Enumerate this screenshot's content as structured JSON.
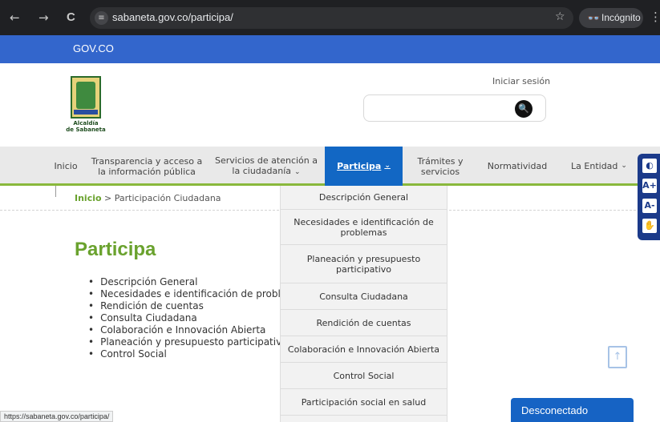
{
  "browser": {
    "url": "sabaneta.gov.co/participa/",
    "back_icon": "←",
    "forward_icon": "→",
    "reload_icon": "C",
    "site_info_icon": "≡",
    "star_icon": "☆",
    "incognito_label": "Incógnito",
    "incognito_icon": "👓",
    "menu_icon": "⋮",
    "status_url": "https://sabaneta.gov.co/participa/"
  },
  "govbar": {
    "label": "GOV.CO",
    "color": "#3366cc"
  },
  "header": {
    "logo_text_line1": "Alcaldía",
    "logo_text_line2": "de Sabaneta",
    "login": "Iniciar sesión",
    "search_placeholder": "",
    "search_icon": "🔍"
  },
  "menu": {
    "items": [
      {
        "label": "Inicio"
      },
      {
        "label": "Transparencia y acceso a la información pública"
      },
      {
        "label": "Servicios de atención a la ciudadanía",
        "caret": "⌄"
      },
      {
        "label": "Participa",
        "caret": "⌄",
        "active": true
      },
      {
        "label": "Trámites y servicios"
      },
      {
        "label": "Normatividad"
      },
      {
        "label": "La Entidad",
        "caret": "⌄"
      }
    ],
    "active_color": "#1267c4",
    "accent_color": "#89b83c"
  },
  "breadcrumb": {
    "home": "Inicio",
    "separator": ">",
    "current": "Participación Ciudadana"
  },
  "page": {
    "title": "Participa",
    "list": [
      "Descripción General",
      "Necesidades e identificación de problemas",
      "Rendición de cuentas",
      "Consulta Ciudadana",
      "Colaboración e Innovación Abierta",
      "Planeación y presupuesto participativo",
      "Control Social"
    ]
  },
  "dropdown": {
    "items": [
      "Descripción General",
      "Necesidades e identificación de problemas",
      "Planeación y presupuesto participativo",
      "Consulta Ciudadana",
      "Rendición de cuentas",
      "Colaboración e Innovación Abierta",
      "Control Social",
      "Participación social en salud"
    ]
  },
  "accessibility": {
    "contrast_icon": "◐",
    "increase_label": "A+",
    "decrease_label": "A-",
    "sign_icon": "✋"
  },
  "upload_icon": "↑",
  "chat": {
    "status": "Desconectado"
  }
}
